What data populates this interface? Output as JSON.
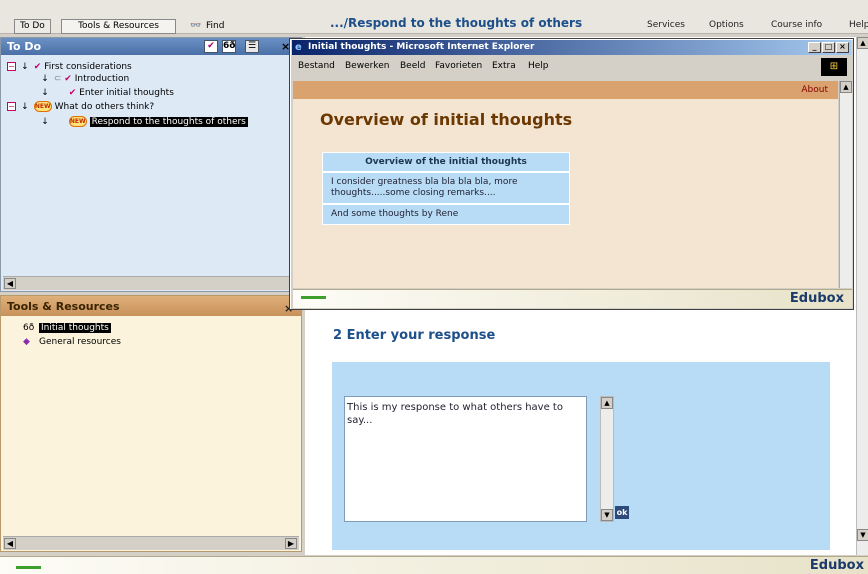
{
  "topbar": {
    "tab_todo": "To Do",
    "tab_tools": "Tools & Resources",
    "find_label": "Find",
    "path_title": ".../Respond to the thoughts of others",
    "menu_services": "Services",
    "menu_options": "Options",
    "menu_course": "Course info",
    "menu_help": "Help"
  },
  "todo": {
    "header": "To Do",
    "items": [
      {
        "label": "First considerations"
      },
      {
        "label": "Introduction"
      },
      {
        "label": "Enter initial thoughts"
      },
      {
        "label": "What do others think?"
      },
      {
        "label": "Respond to the thoughts of others"
      }
    ]
  },
  "tools": {
    "header": "Tools & Resources",
    "items": [
      {
        "label": "Initial thoughts"
      },
      {
        "label": "General resources"
      }
    ]
  },
  "main": {
    "section_title": "2 Enter your response",
    "response_text": "This is my response to what others have to say...",
    "ok_label": "ok"
  },
  "popup": {
    "window_title": "Initial thoughts - Microsoft Internet Explorer",
    "menu": [
      "Bestand",
      "Bewerken",
      "Beeld",
      "Favorieten",
      "Extra",
      "Help"
    ],
    "about_label": "About",
    "heading": "Overview of initial thoughts",
    "table_header": "Overview of the initial thoughts",
    "rows": [
      "I consider greatness bla bla bla bla, more thoughts.....some closing remarks....",
      "And some thoughts by Rene"
    ],
    "brand": "Edubox"
  },
  "status": {
    "brand": "Edubox"
  },
  "colors": {
    "accent_blue": "#1d4f8a",
    "todo_panel_bg": "#ddeaf6",
    "tools_header_bg": "#d9a26e",
    "check_mark": "#c8006e",
    "progress_green": "#3da02d"
  }
}
